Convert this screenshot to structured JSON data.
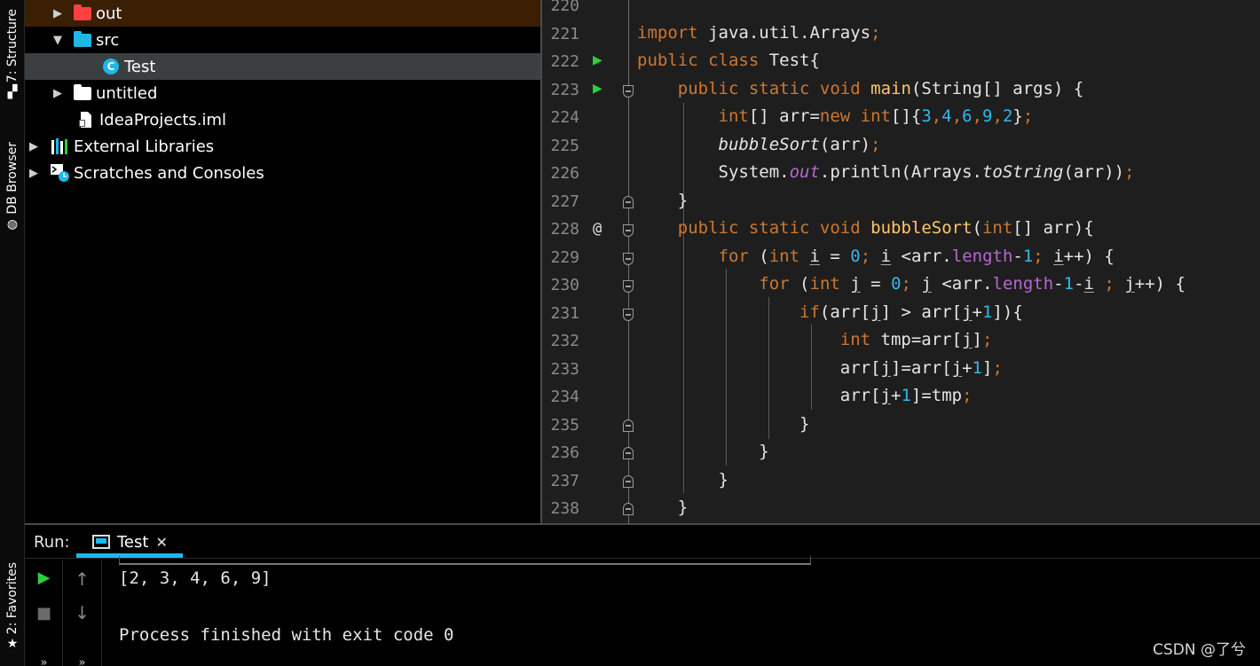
{
  "side_strip": {
    "structure_label": "7: Structure",
    "db_browser_label": "DB Browser",
    "favorites_label": "2: Favorites"
  },
  "project_tree": {
    "items": [
      {
        "label": "out",
        "type": "folder",
        "color": "#ff4040",
        "expanded": false
      },
      {
        "label": "src",
        "type": "folder",
        "color": "#1db8e8",
        "expanded": true
      },
      {
        "label": "Test",
        "type": "class",
        "selected": true
      },
      {
        "label": "untitled",
        "type": "folder",
        "color": "#ffffff",
        "expanded": false
      },
      {
        "label": "IdeaProjects.iml",
        "type": "file"
      },
      {
        "label": "External Libraries",
        "type": "libraries",
        "expanded": false
      },
      {
        "label": "Scratches and Consoles",
        "type": "scratches",
        "expanded": false
      }
    ]
  },
  "editor": {
    "line_numbers": [
      "220",
      "221",
      "222",
      "223",
      "224",
      "225",
      "226",
      "227",
      "228",
      "229",
      "230",
      "231",
      "232",
      "233",
      "234",
      "235",
      "236",
      "237",
      "238"
    ],
    "gutter_run_marker": "▶",
    "gutter_override_marker": "@"
  },
  "run_panel": {
    "label": "Run:",
    "tab_label": "Test",
    "output_line_1": "[2, 3, 4, 6, 9]",
    "output_line_2": "Process finished with exit code 0"
  },
  "watermark": "CSDN @了兮",
  "colors": {
    "keyword": "#cc7832",
    "function": "#ffc66d",
    "number": "#2fb8ee",
    "field": "#b667d3",
    "run_green": "#2ecc40",
    "accent": "#1db8e8"
  }
}
